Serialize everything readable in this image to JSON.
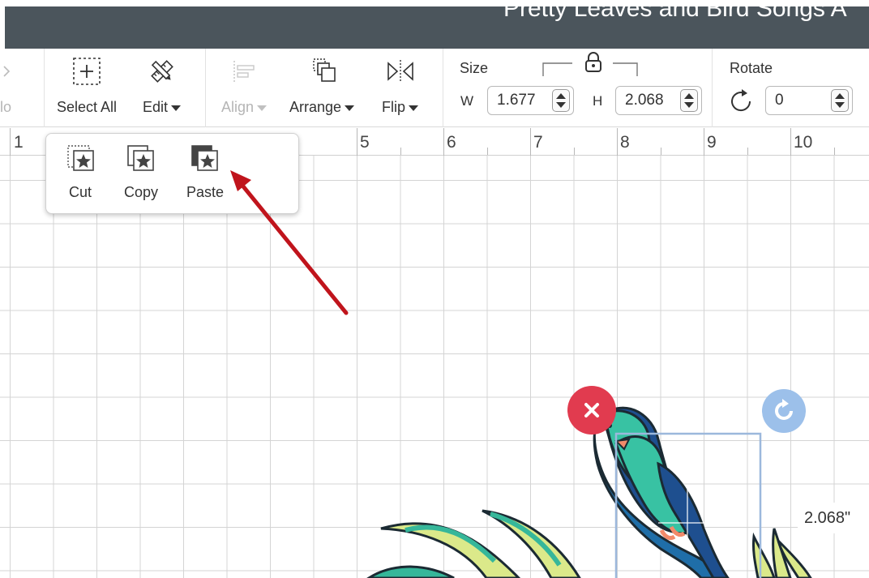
{
  "project": {
    "title": "Pretty Leaves and Bird Songs A"
  },
  "toolbar": {
    "partial_left_label": "lo",
    "select_all": "Select All",
    "edit": "Edit",
    "align": "Align",
    "arrange": "Arrange",
    "flip": "Flip",
    "size_label": "Size",
    "width_letter": "W",
    "width_value": "1.677",
    "height_letter": "H",
    "height_value": "2.068",
    "rotate_label": "Rotate",
    "rotate_value": "0"
  },
  "edit_menu": {
    "cut": "Cut",
    "copy": "Copy",
    "paste": "Paste"
  },
  "ruler": {
    "labels": [
      "1",
      "5",
      "6",
      "7",
      "8",
      "9",
      "10"
    ]
  },
  "selection": {
    "height_readout": "2.068\""
  },
  "colors": {
    "title_bar": "#4b555c",
    "delete_red": "#e13b4f",
    "rotate_blue": "#9cc0ea",
    "annotation_arrow": "#c0141c",
    "selection_box": "#9cb8dc"
  },
  "icons": [
    "chevron-right-icon",
    "select-all-icon",
    "edit-pencil-ruler-icon",
    "align-icon",
    "arrange-icon",
    "flip-icon",
    "lock-icon",
    "rotate-icon",
    "cut-icon",
    "copy-icon",
    "paste-icon",
    "delete-icon",
    "rotate-handle-icon"
  ]
}
